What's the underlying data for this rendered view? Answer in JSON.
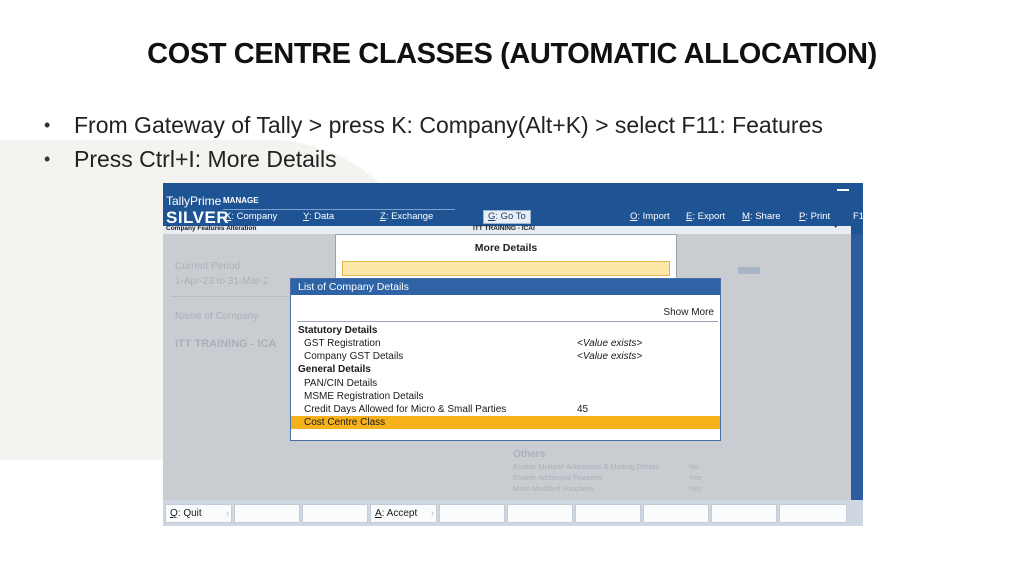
{
  "slide": {
    "title": "COST CENTRE CLASSES (AUTOMATIC ALLOCATION)",
    "bullets": [
      "From Gateway of Tally > press K: Company(Alt+K) > select F11: Features",
      "Press Ctrl+I: More Details"
    ]
  },
  "tally": {
    "brand": "TallyPrime",
    "edition_label": "MANAGE",
    "edition": "SILVER",
    "menu": {
      "company": {
        "key": "K",
        "label": ": Company"
      },
      "data": {
        "key": "Y",
        "label": ": Data"
      },
      "exchange": {
        "key": "Z",
        "label": ": Exchange"
      },
      "goto": {
        "key": "G",
        "label": ": Go To"
      },
      "import": {
        "key": "O",
        "label": ": Import"
      },
      "export": {
        "key": "E",
        "label": ": Export"
      },
      "share": {
        "key": "M",
        "label": ": Share"
      },
      "print": {
        "key": "P",
        "label": ": Print"
      },
      "f1": "F1"
    },
    "breadcrumb": "Company Features  Alteration",
    "company_name": "ITT TRAINING - ICAI",
    "background": {
      "period_label": "Current Period",
      "period": "1-Apr-23 to 31-Mar-2",
      "company_label": "Name of Company",
      "company": "ITT TRAINING - ICA",
      "others": "Others",
      "other_rows": [
        "Enable Multiple Addresses & Mailing Details",
        "Enable Additional Features",
        "Mark Modified Vouchers"
      ],
      "other_values": [
        "No",
        "Yes",
        "Yes"
      ]
    },
    "more_details": {
      "title": "More Details"
    },
    "list": {
      "title": "List of Company Details",
      "show_more": "Show More",
      "rows": [
        {
          "label": "Statutory Details",
          "value": ""
        },
        {
          "label": "GST Registration",
          "value": "<Value exists>"
        },
        {
          "label": "Company GST Details",
          "value": "<Value exists>"
        },
        {
          "label": "General Details",
          "value": ""
        },
        {
          "label": "PAN/CIN Details",
          "value": ""
        },
        {
          "label": "MSME Registration Details",
          "value": ""
        },
        {
          "label": "Credit Days Allowed for Micro & Small Parties",
          "value": "45"
        },
        {
          "label": "Cost Centre Class",
          "value": ""
        }
      ]
    },
    "buttons": {
      "quit": {
        "key": "Q",
        "label": ": Quit"
      },
      "accept": {
        "key": "A",
        "label": ": Accept"
      }
    },
    "colors": {
      "frame": "#1f5494",
      "highlight": "#f7b21b",
      "input_bg": "#fde7a8"
    }
  }
}
